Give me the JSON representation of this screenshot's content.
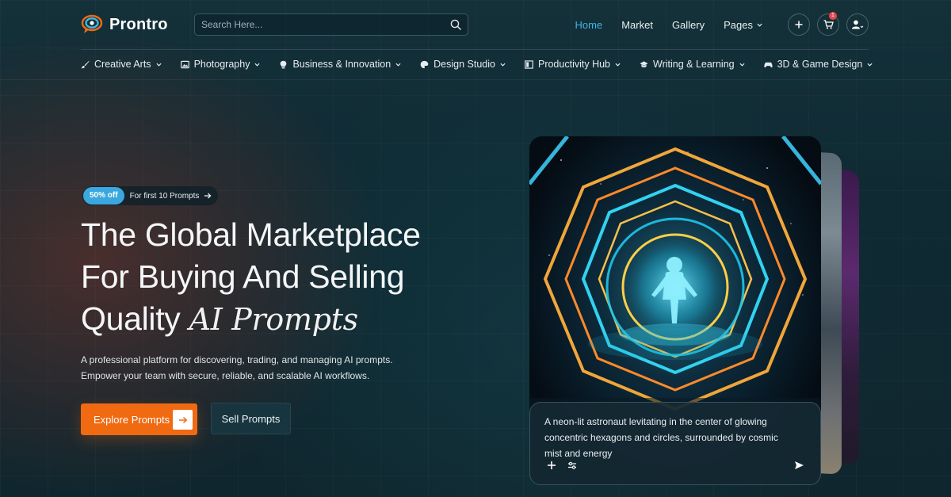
{
  "brand": {
    "name": "Prontro",
    "colors": {
      "accent": "#3fb7e6",
      "orange": "#f06a12",
      "promo": "#3aa7de",
      "badge": "#e5484d"
    }
  },
  "search": {
    "placeholder": "Search Here...",
    "value": "",
    "icon": "search-icon"
  },
  "nav": {
    "links": [
      {
        "label": "Home",
        "active": true
      },
      {
        "label": "Market"
      },
      {
        "label": "Gallery"
      },
      {
        "label": "Pages",
        "dropdown": true
      }
    ],
    "cart_count": "1",
    "icons": [
      "plus-icon",
      "cart-icon",
      "user-icon"
    ]
  },
  "categories": [
    {
      "label": "Creative Arts",
      "icon": "brush-icon"
    },
    {
      "label": "Photography",
      "icon": "image-icon"
    },
    {
      "label": "Business & Innovation",
      "icon": "bulb-icon"
    },
    {
      "label": "Design Studio",
      "icon": "palette-icon"
    },
    {
      "label": "Productivity Hub",
      "icon": "panel-icon"
    },
    {
      "label": "Writing & Learning",
      "icon": "graduation-cap-icon"
    },
    {
      "label": "3D & Game Design",
      "icon": "gamepad-icon"
    }
  ],
  "hero": {
    "promo_badge": "50% off",
    "promo_text": "For first 10 Prompts",
    "headline_line1": "The Global Marketplace",
    "headline_line2": "For Buying And Selling",
    "headline_line3_plain": "Quality ",
    "headline_line3_accent": "AI Prompts",
    "description_line1": "A professional platform for discovering, trading, and managing AI prompts.",
    "description_line2": "Empower your team with secure, reliable, and scalable AI workflows.",
    "primary_button": "Explore Prompts",
    "secondary_button": "Sell Prompts"
  },
  "card": {
    "caption": "A neon-lit astronaut levitating in the center of glowing concentric hexagons and circles, surrounded by cosmic mist and energy",
    "actions": [
      "plus-icon",
      "sliders-icon",
      "send-icon"
    ]
  }
}
